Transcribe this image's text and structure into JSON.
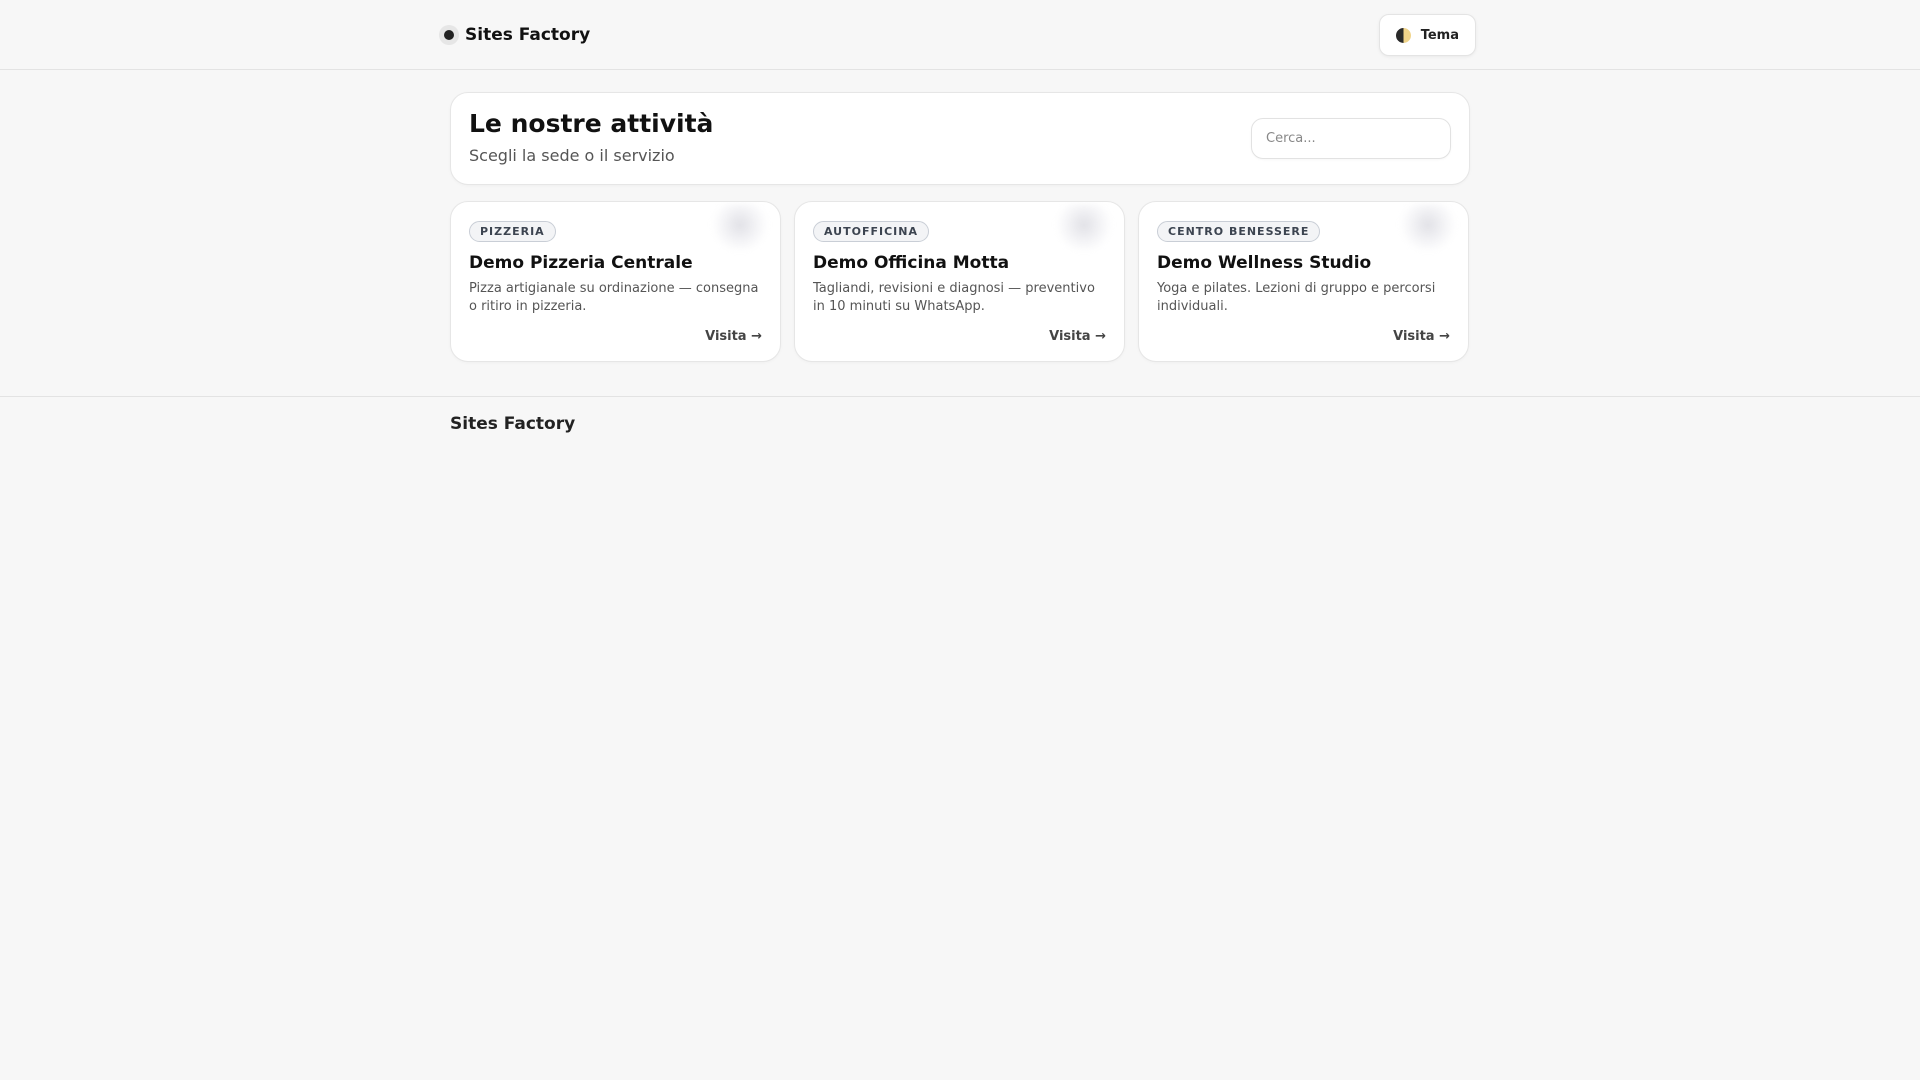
{
  "header": {
    "brand_name": "Sites Factory",
    "theme_label": "Tema"
  },
  "hero": {
    "title": "Le nostre attività",
    "subtitle": "Scegli la sede o il servizio",
    "search_placeholder": "Cerca..."
  },
  "cards": [
    {
      "badge": "PIZZERIA",
      "title": "Demo Pizzeria Centrale",
      "description": "Pizza artigianale su ordinazione — consegna o ritiro in pizzeria.",
      "link_label": "Visita →"
    },
    {
      "badge": "AUTOFFICINA",
      "title": "Demo Officina Motta",
      "description": "Tagliandi, revisioni e diagnosi — preventivo in 10 minuti su WhatsApp.",
      "link_label": "Visita →"
    },
    {
      "badge": "CENTRO BENESSERE",
      "title": "Demo Wellness Studio",
      "description": "Yoga e pilates. Lezioni di gruppo e percorsi individuali.",
      "link_label": "Visita →"
    }
  ],
  "footer": {
    "brand_name": "Sites Factory"
  },
  "icons": {
    "brand": "dot-logo-icon",
    "theme": "half-moon-icon"
  }
}
